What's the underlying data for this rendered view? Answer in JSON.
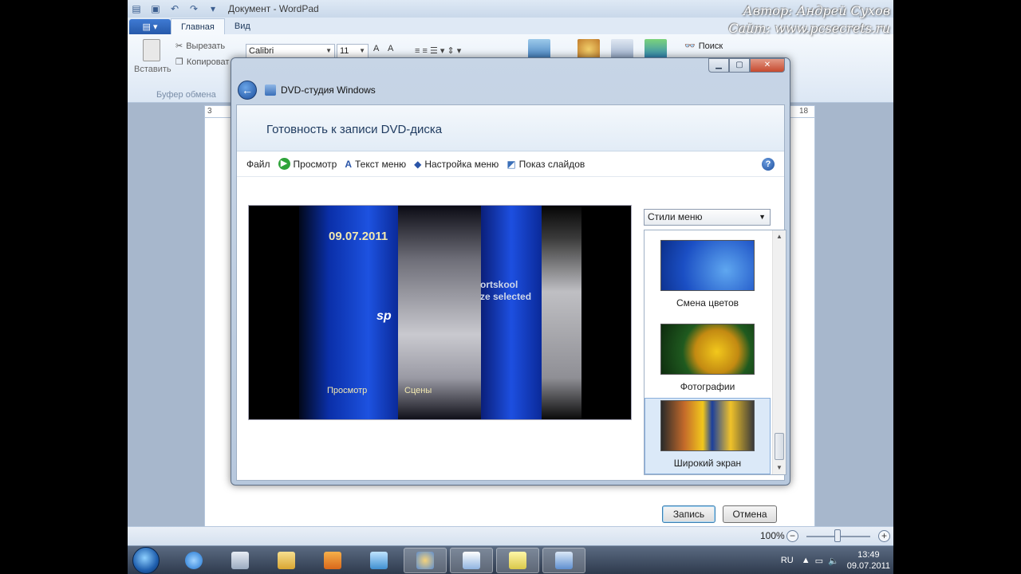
{
  "wordpad": {
    "title": "Документ - WordPad",
    "tabs": [
      "Главная",
      "Вид"
    ],
    "ribbon": {
      "cut": "Вырезать",
      "copy": "Копироват",
      "paste": "Вставить",
      "clipboard_group": "Буфер обмена",
      "font_name": "Calibri",
      "font_size": "11",
      "find": "Поиск"
    },
    "ruler": {
      "left": "3",
      "right": "18"
    },
    "status": {
      "zoom": "100%"
    }
  },
  "watermark": {
    "line1": "Автор: Андрей Сухов",
    "line2": "Сайт: www.pcsecrets.ru"
  },
  "dialog": {
    "app_title": "DVD-студия Windows",
    "heading": "Готовность к записи DVD-диска",
    "toolbar": {
      "file": "Файл",
      "preview": "Просмотр",
      "menu_text": "Текст меню",
      "menu_settings": "Настройка меню",
      "slideshow": "Показ слайдов"
    },
    "preview": {
      "date": "09.07.2011",
      "menu_play": "Просмотр",
      "menu_scenes": "Сцены",
      "partial_text_1": "ortskool",
      "partial_text_2": "ze selected",
      "partial_text_3": "sp"
    },
    "styles_select": "Стили меню",
    "styles": [
      {
        "label": "Смена цветов",
        "selected": false
      },
      {
        "label": "Фотографии",
        "selected": false
      },
      {
        "label": "Широкий экран",
        "selected": true
      }
    ],
    "buttons": {
      "burn": "Запись",
      "cancel": "Отмена"
    }
  },
  "taskbar": {
    "language": "RU",
    "time": "13:49",
    "date": "09.07.2011"
  }
}
